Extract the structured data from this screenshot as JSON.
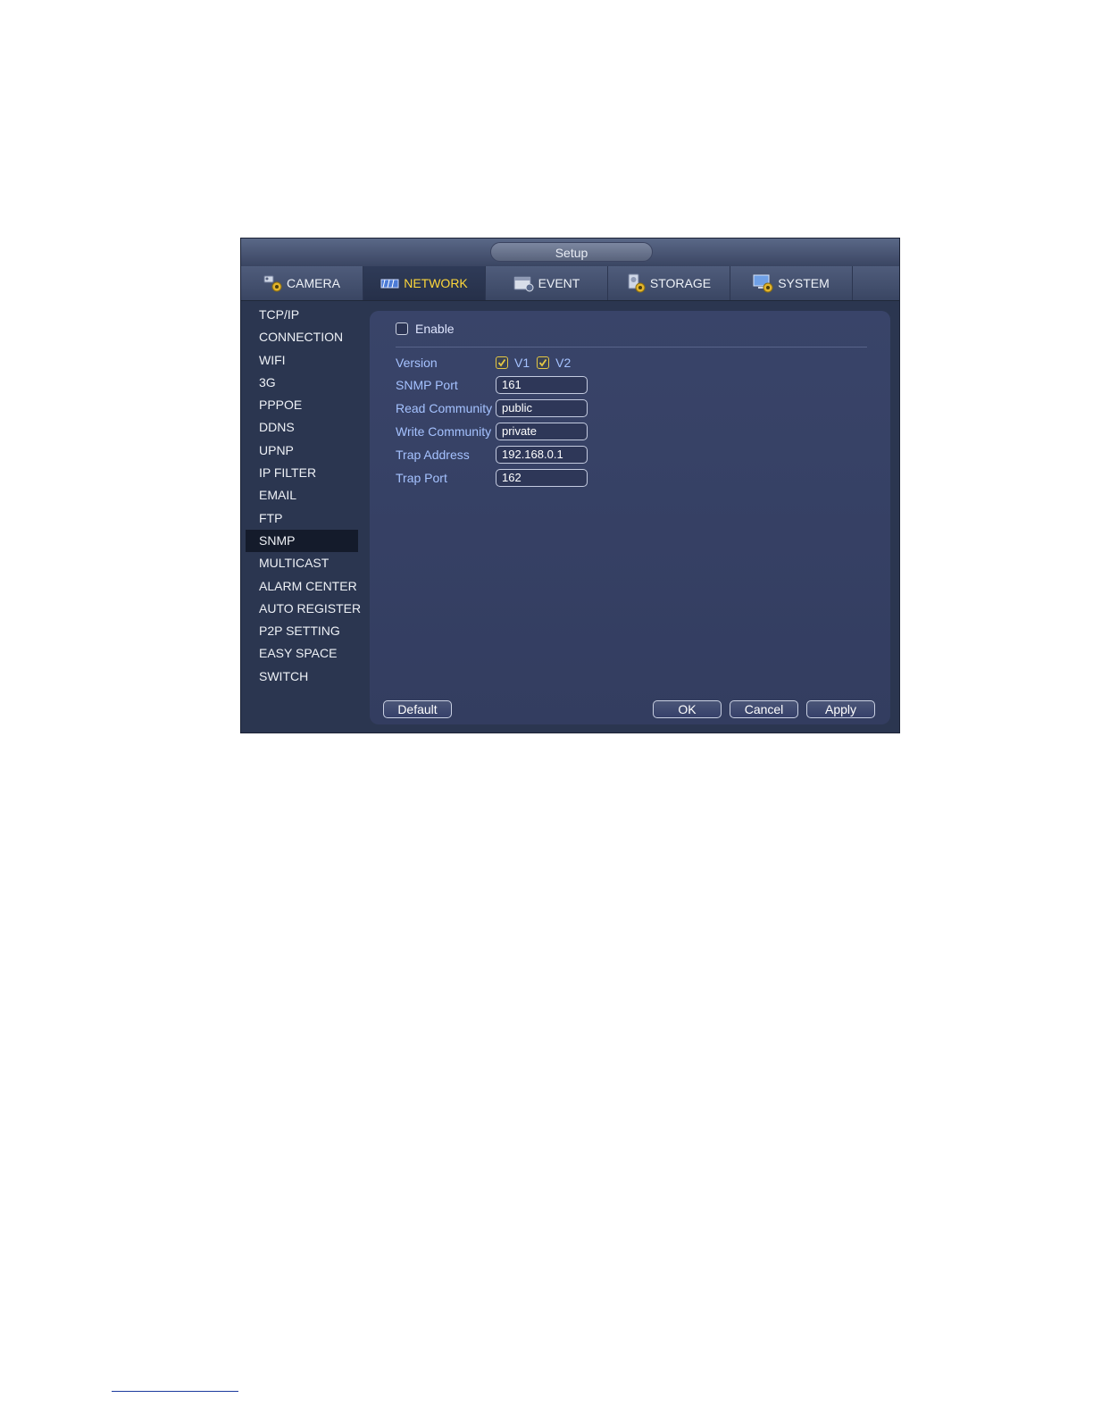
{
  "window": {
    "title": "Setup"
  },
  "tabs": [
    {
      "label": "CAMERA",
      "icon": "camera-gear-icon",
      "active": false
    },
    {
      "label": "NETWORK",
      "icon": "network-icon",
      "active": true
    },
    {
      "label": "EVENT",
      "icon": "event-icon",
      "active": false
    },
    {
      "label": "STORAGE",
      "icon": "storage-gear-icon",
      "active": false
    },
    {
      "label": "SYSTEM",
      "icon": "system-gear-icon",
      "active": false
    }
  ],
  "sidebar": {
    "items": [
      {
        "label": "TCP/IP"
      },
      {
        "label": "CONNECTION"
      },
      {
        "label": "WIFI"
      },
      {
        "label": "3G"
      },
      {
        "label": "PPPOE"
      },
      {
        "label": "DDNS"
      },
      {
        "label": "UPNP"
      },
      {
        "label": "IP FILTER"
      },
      {
        "label": "EMAIL"
      },
      {
        "label": "FTP"
      },
      {
        "label": "SNMP",
        "active": true
      },
      {
        "label": "MULTICAST"
      },
      {
        "label": "ALARM CENTER"
      },
      {
        "label": "AUTO REGISTER"
      },
      {
        "label": "P2P SETTING"
      },
      {
        "label": "EASY SPACE"
      },
      {
        "label": "SWITCH"
      }
    ]
  },
  "form": {
    "enable": {
      "label": "Enable",
      "checked": false
    },
    "version": {
      "label": "Version",
      "options": [
        {
          "label": "V1",
          "checked": true
        },
        {
          "label": "V2",
          "checked": true
        }
      ]
    },
    "snmp_port": {
      "label": "SNMP Port",
      "value": "161"
    },
    "read_community": {
      "label": "Read Community",
      "value": "public"
    },
    "write_community": {
      "label": "Write Community",
      "value": "private"
    },
    "trap_address": {
      "label": "Trap Address",
      "value": "192.168.0.1"
    },
    "trap_port": {
      "label": "Trap Port",
      "value": "162"
    }
  },
  "buttons": {
    "default": "Default",
    "ok": "OK",
    "cancel": "Cancel",
    "apply": "Apply"
  },
  "colors": {
    "active_tab_text": "#ffd83a",
    "label_blue": "#a5c2ff",
    "checkbox_check": "#e6c844"
  }
}
